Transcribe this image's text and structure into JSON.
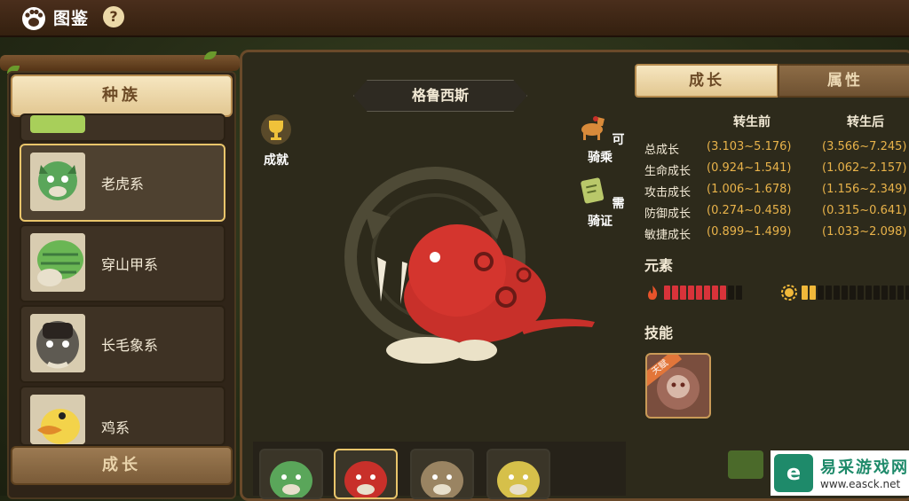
{
  "header": {
    "title": "图鉴",
    "help_glyph": "?"
  },
  "left": {
    "top_tab": "种族",
    "bottom_tab": "成长",
    "items": [
      {
        "label": "",
        "avatar_color": "#a8cf5a"
      },
      {
        "label": "老虎系",
        "avatar_color": "#5aa65a",
        "selected": true
      },
      {
        "label": "穿山甲系",
        "avatar_color": "#6ab654"
      },
      {
        "label": "长毛象系",
        "avatar_color": "#5e5a52"
      },
      {
        "label": "鸡系",
        "avatar_color": "#f3d34a"
      }
    ]
  },
  "creature": {
    "name": "格鲁西斯"
  },
  "side_icons": {
    "achievement": "成就",
    "rideable": "可骑乘",
    "license": "需骑证"
  },
  "stats": {
    "tab_growth": "成长",
    "tab_attr": "属性",
    "col_before": "转生前",
    "col_after": "转生后",
    "rows": [
      {
        "label": "总成长",
        "before": "(3.103~5.176)",
        "after": "(3.566~7.245)"
      },
      {
        "label": "生命成长",
        "before": "(0.924~1.541)",
        "after": "(1.062~2.157)"
      },
      {
        "label": "攻击成长",
        "before": "(1.006~1.678)",
        "after": "(1.156~2.349)"
      },
      {
        "label": "防御成长",
        "before": "(0.274~0.458)",
        "after": "(0.315~0.641)"
      },
      {
        "label": "敏捷成长",
        "before": "(0.899~1.499)",
        "after": "(1.033~2.098)"
      }
    ],
    "elements_title": "元素",
    "fire_level": 8,
    "fire_total": 10,
    "light_level": 2,
    "light_total": 14,
    "skills_title": "技能",
    "skill_tag": "天赋"
  },
  "thumbs": [
    {
      "color": "#5aa65a"
    },
    {
      "color": "#c8302a",
      "selected": true
    },
    {
      "color": "#9a8462"
    },
    {
      "color": "#d6c04a"
    }
  ],
  "watermark": {
    "logo": "e",
    "name": "易采游戏网",
    "url": "www.easck.net"
  },
  "colors": {
    "accent": "#e9b34a",
    "fire": "#d8333a",
    "light": "#f0b83a",
    "selected_border": "#e9c56b"
  }
}
